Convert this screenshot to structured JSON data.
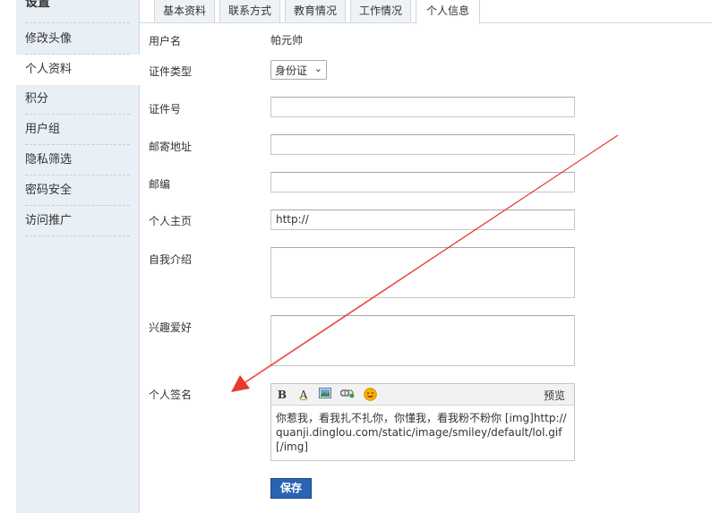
{
  "sidebar": {
    "title": "设置",
    "items": [
      {
        "label": "修改头像"
      },
      {
        "label": "个人资料"
      },
      {
        "label": "积分"
      },
      {
        "label": "用户组"
      },
      {
        "label": "隐私筛选"
      },
      {
        "label": "密码安全"
      },
      {
        "label": "访问推广"
      }
    ]
  },
  "tabs": [
    {
      "label": "基本资料"
    },
    {
      "label": "联系方式"
    },
    {
      "label": "教育情况"
    },
    {
      "label": "工作情况"
    },
    {
      "label": "个人信息"
    }
  ],
  "form": {
    "username_label": "用户名",
    "username_value": "帕元帅",
    "id_type_label": "证件类型",
    "id_type_value": "身份证",
    "id_number_label": "证件号",
    "address_label": "邮寄地址",
    "zip_label": "邮编",
    "homepage_label": "个人主页",
    "homepage_value": "http://",
    "bio_label": "自我介绍",
    "hobby_label": "兴趣爱好",
    "signature_label": "个人签名",
    "signature_text": "你惹我，看我扎不扎你，你懂我，看我粉不粉你 [img]http://quanji.dinglou.com/static/image/smiley/default/lol.gif[/img]",
    "preview_label": "预览",
    "save_label": "保存"
  },
  "toolbar": {
    "bold": "B",
    "font_color": "A"
  },
  "colors": {
    "sidebar_bg": "#e8eff5",
    "save_button": "#2a63b2",
    "annotation_arrow": "#e53b2c"
  }
}
